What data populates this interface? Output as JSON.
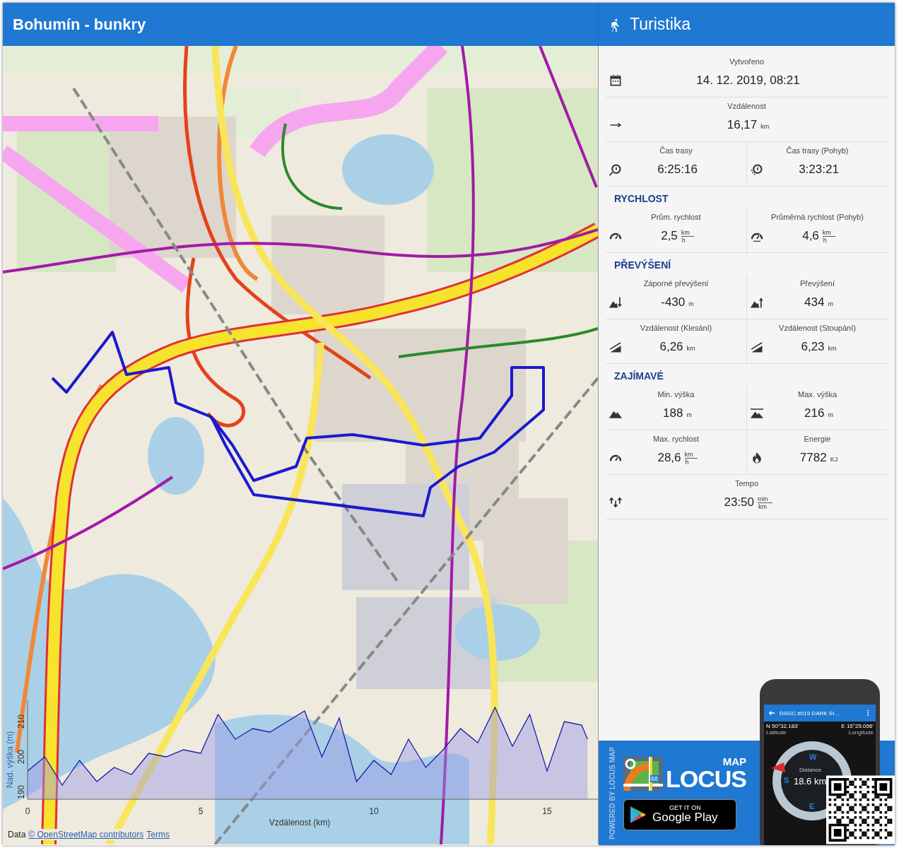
{
  "header": {
    "title": "Bohumín - bunkry",
    "panel_title": "Turistika"
  },
  "map": {
    "attribution": {
      "prefix": "Data",
      "links": [
        "© OpenStreetMap contributors",
        "Terms"
      ]
    },
    "elevation": {
      "chart_data": {
        "type": "area",
        "xlabel": "Vzdálenost (km)",
        "ylabel": "Nad. výška (m)",
        "x": [
          0,
          0.5,
          1,
          1.5,
          2,
          2.5,
          3,
          3.5,
          4,
          4.5,
          5,
          5.5,
          6,
          6.5,
          7,
          7.5,
          8,
          8.5,
          9,
          9.5,
          10,
          10.5,
          11,
          11.5,
          12,
          12.5,
          13,
          13.5,
          14,
          14.5,
          15,
          15.5,
          16,
          16.17
        ],
        "series": [
          {
            "color": "#1a1aa8",
            "values": [
              196,
              200,
              192,
              199,
              193,
              197,
              195,
              201,
              200,
              202,
              201,
              212,
              205,
              208,
              207,
              210,
              213,
              200,
              211,
              193,
              199,
              195,
              205,
              197,
              202,
              208,
              204,
              214,
              203,
              212,
              196,
              210,
              209,
              205
            ]
          }
        ],
        "xlim": [
          0,
          17
        ],
        "ylim": [
          188,
          216
        ],
        "xticks": [
          0,
          5,
          10,
          15
        ],
        "yticks": [
          190,
          200,
          210
        ]
      }
    }
  },
  "stats": {
    "sections": [
      {
        "rows": [
          [
            {
              "label": "Vytvořeno",
              "value": "14. 12. 2019, 08:21"
            }
          ],
          [
            {
              "label": "Vzdálenost",
              "value": "16,17",
              "unit": "km"
            }
          ],
          [
            {
              "label": "Čas trasy",
              "value": "6:25:16"
            },
            {
              "label": "Čas trasy (Pohyb)",
              "value": "3:23:21"
            }
          ]
        ]
      },
      {
        "heading": "RYCHLOST",
        "rows": [
          [
            {
              "label": "Prům. rychlost",
              "value": "2,5",
              "unit_fraction": [
                "km",
                "h"
              ]
            },
            {
              "label": "Průměrná rychlost (Pohyb)",
              "value": "4,6",
              "unit_fraction": [
                "km",
                "h"
              ]
            }
          ]
        ]
      },
      {
        "heading": "PŘEVÝŠENÍ",
        "rows": [
          [
            {
              "label": "Záporné převýšení",
              "value": "-430",
              "unit": "m"
            },
            {
              "label": "Převýšení",
              "value": "434",
              "unit": "m"
            }
          ],
          [
            {
              "label": "Vzdálenost (Klesání)",
              "value": "6,26",
              "unit": "km"
            },
            {
              "label": "Vzdálenost (Stoupání)",
              "value": "6,23",
              "unit": "km"
            }
          ]
        ]
      },
      {
        "heading": "ZAJÍMAVÉ",
        "rows": [
          [
            {
              "label": "Min. výška",
              "value": "188",
              "unit": "m"
            },
            {
              "label": "Max. výška",
              "value": "216",
              "unit": "m"
            }
          ],
          [
            {
              "label": "Max. rychlost",
              "value": "28,6",
              "unit_fraction": [
                "km",
                "h"
              ]
            },
            {
              "label": "Energie",
              "value": "7782",
              "unit": "KJ"
            }
          ],
          [
            {
              "label": "Tempo",
              "value": "23:50",
              "unit_fraction": [
                "min",
                "km"
              ]
            }
          ]
        ]
      }
    ]
  },
  "promo": {
    "tagline": "POWERED BY LOCUS MAP",
    "logo": {
      "small": "MAP",
      "large": "LOCUS",
      "badge": "68"
    },
    "store_button": {
      "line1": "GET IT ON",
      "line2": "Google Play"
    },
    "phone": {
      "title": "DSGC #019 DARK SI…",
      "latitude": "N 50°32.183'",
      "latitude_label": "Latitude",
      "longitude": "E 15°25.056'",
      "longitude_label": "Longitude",
      "compass_letters": [
        "W",
        "S",
        "E"
      ],
      "distance_label": "Distance",
      "distance": "18.6 km"
    }
  }
}
